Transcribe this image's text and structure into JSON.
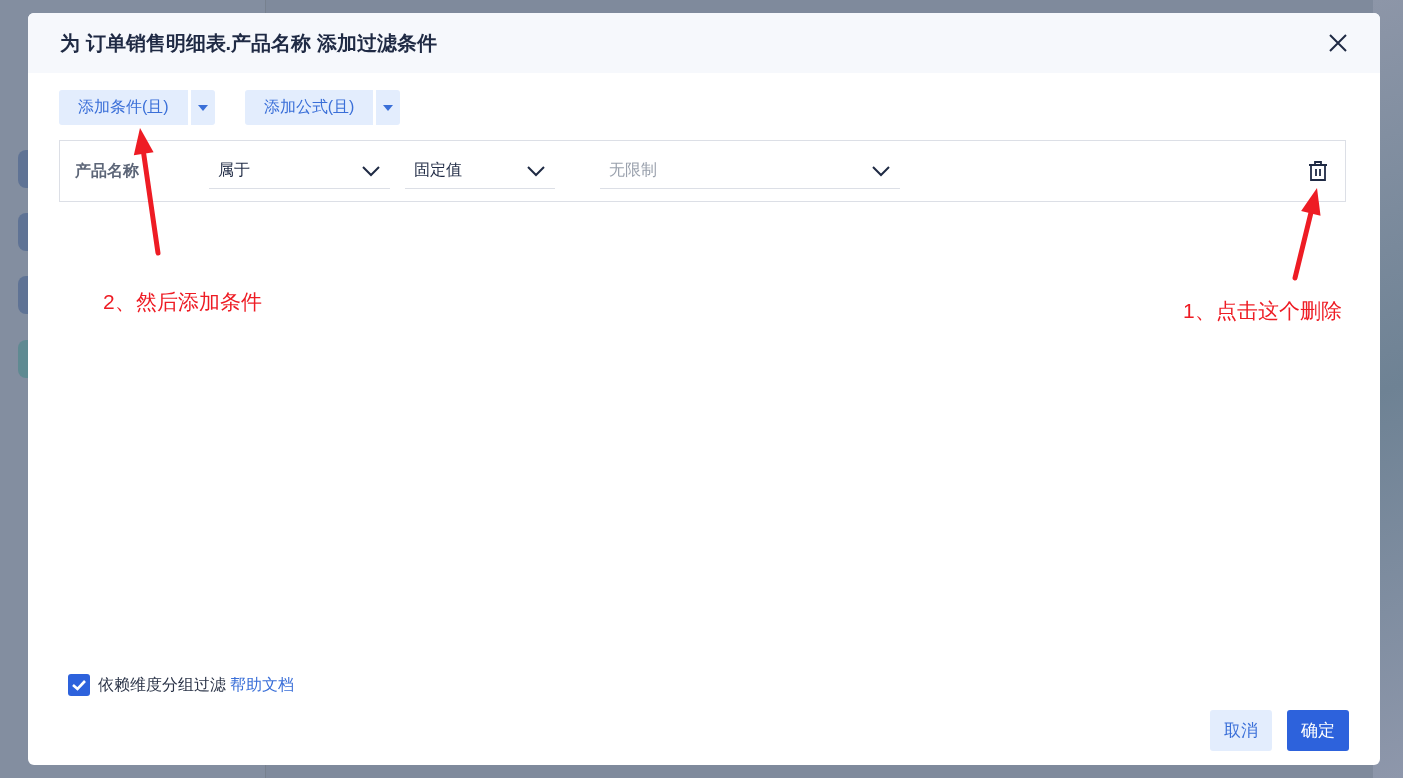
{
  "dialog": {
    "title": "为 订单销售明细表.产品名称 添加过滤条件",
    "toolbar": [
      {
        "label": "添加条件(且)"
      },
      {
        "label": "添加公式(且)"
      }
    ],
    "conditions": [
      {
        "field": "产品名称",
        "operator": "属于",
        "value_type": "固定值",
        "value_placeholder": "无限制"
      }
    ],
    "footer": {
      "option": {
        "label": "依赖维度分组过滤",
        "checked": true
      },
      "help_link": "帮助文档",
      "buttons": [
        {
          "label": "取消",
          "kind": "secondary"
        },
        {
          "label": "确定",
          "kind": "primary"
        }
      ]
    }
  },
  "annotations": [
    {
      "text": "2、然后添加条件"
    },
    {
      "text": "1、点击这个删除"
    }
  ]
}
